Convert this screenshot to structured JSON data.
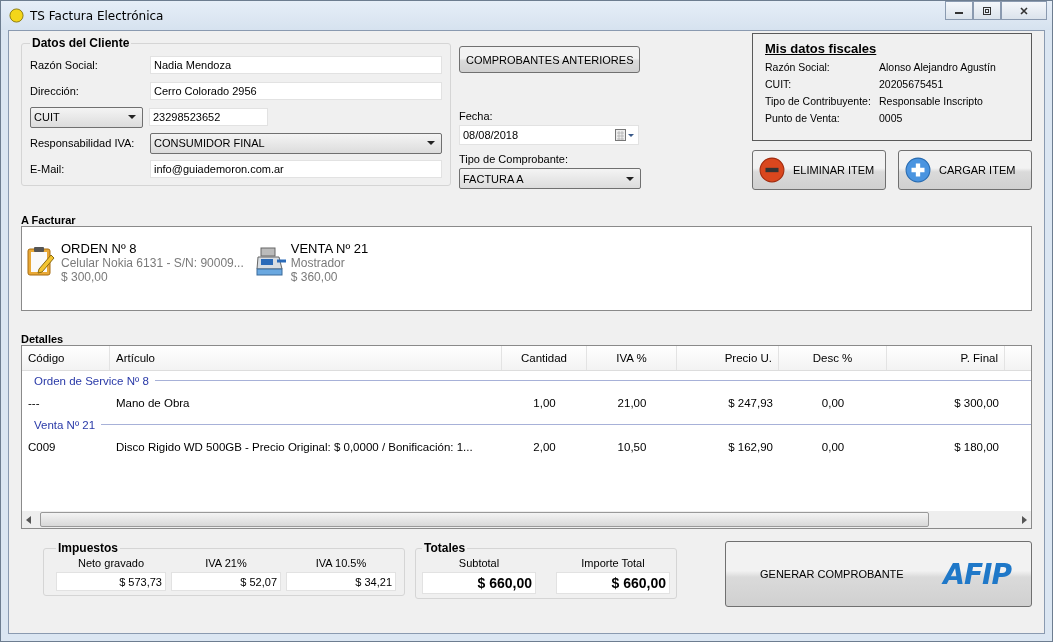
{
  "window": {
    "title": "TS Factura Electrónica"
  },
  "cliente": {
    "title": "Datos del Cliente",
    "fields": [
      {
        "kind": "text",
        "label": "Razón Social:",
        "value": "Nadia Mendoza"
      },
      {
        "kind": "text",
        "label": "Dirección:",
        "value": "Cerro Colorado 2956"
      },
      {
        "kind": "doc",
        "selector": "CUIT",
        "value": "23298523652"
      },
      {
        "kind": "combo",
        "label": "Responsabilidad IVA:",
        "value": "CONSUMIDOR FINAL"
      },
      {
        "kind": "text",
        "label": "E-Mail:",
        "value": "info@guiademoron.com.ar"
      }
    ]
  },
  "comprobantes_button": "COMPROBANTES ANTERIORES",
  "fecha": {
    "label": "Fecha:",
    "value": "08/08/2018"
  },
  "tipo_comprobante": {
    "label": "Tipo de Comprobante:",
    "value": "FACTURA A"
  },
  "fiscal": {
    "title": "Mis datos fiscales",
    "rows": [
      {
        "label": "Razón Social:",
        "value": "Alonso Alejandro Agustín"
      },
      {
        "label": "CUIT:",
        "value": "20205675451"
      },
      {
        "label": "Tipo de Contribuyente:",
        "value": "Responsable Inscripto"
      },
      {
        "label": "Punto de Venta:",
        "value": "0005"
      }
    ]
  },
  "item_buttons": [
    {
      "kind": "remove",
      "label": "ELIMINAR ITEM"
    },
    {
      "kind": "add",
      "label": "CARGAR ITEM"
    }
  ],
  "a_facturar": {
    "title": "A Facturar",
    "items": [
      {
        "kind": "orden",
        "title": "ORDEN Nº 8",
        "description": "Celular Nokia 6131 - S/N: 90009...",
        "amount": "$ 300,00"
      },
      {
        "kind": "venta",
        "title": "VENTA Nº 21",
        "description": "Mostrador",
        "amount": "$ 360,00"
      }
    ]
  },
  "detalles": {
    "title": "Detalles",
    "columns": [
      "Código",
      "Artículo",
      "Cantidad",
      "IVA %",
      "Precio U.",
      "Desc %",
      "P. Final"
    ],
    "groups": [
      {
        "title": "Orden de Service Nº 8",
        "rows": [
          [
            "---",
            "Mano de Obra",
            "1,00",
            "21,00",
            "$ 247,93",
            "0,00",
            "$ 300,00"
          ]
        ]
      },
      {
        "title": "Venta Nº 21",
        "rows": [
          [
            "C009",
            "Disco Rigido WD 500GB - Precio Original: $ 0,0000 / Bonificación: 1...",
            "2,00",
            "10,50",
            "$ 162,90",
            "0,00",
            "$ 180,00"
          ]
        ]
      }
    ]
  },
  "impuestos": {
    "title": "Impuestos",
    "fields": [
      {
        "label": "Neto gravado",
        "value": "$ 573,73"
      },
      {
        "label": "IVA 21%",
        "value": "$ 52,07"
      },
      {
        "label": "IVA 10.5%",
        "value": "$ 34,21"
      }
    ]
  },
  "totales": {
    "title": "Totales",
    "fields": [
      {
        "label": "Subtotal",
        "value": "$ 660,00"
      },
      {
        "label": "Importe Total",
        "value": "$ 660,00"
      }
    ]
  },
  "generar_button": {
    "label": "GENERAR COMPROBANTE",
    "logo": "AFIP"
  }
}
